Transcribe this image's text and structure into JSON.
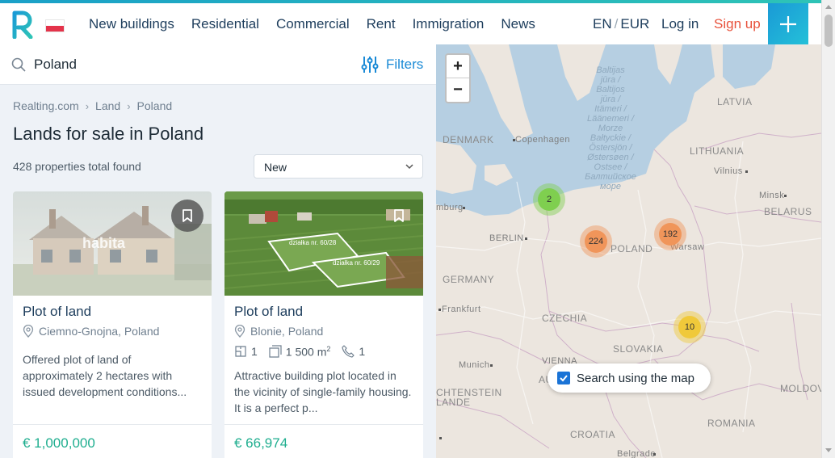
{
  "header": {
    "nav": [
      "New buildings",
      "Residential",
      "Commercial",
      "Rent",
      "Immigration",
      "News"
    ],
    "lang": "EN",
    "currency": "EUR",
    "login": "Log in",
    "signup": "Sign up",
    "accent_color": "#1a9ad6",
    "signup_color": "#e8523c"
  },
  "search": {
    "value": "Poland",
    "filters_label": "Filters"
  },
  "breadcrumb": [
    "Realting.com",
    "Land",
    "Poland"
  ],
  "page_title": "Lands for sale in Poland",
  "total_found": "428 properties total found",
  "sort": {
    "selected": "New"
  },
  "listings": [
    {
      "title": "Plot of land",
      "location": "Ciemno-Gnojna, Poland",
      "image_watermark": "habita",
      "description": "Offered plot of land of approximately 2 hectares with issued development conditions...",
      "price": "€ 1,000,000"
    },
    {
      "title": "Plot of land",
      "location": "Blonie, Poland",
      "plot_label_1": "działka nr. 60/28",
      "plot_label_2": "działka nr. 60/29",
      "features": {
        "rooms": "1",
        "area": "1 500 m",
        "area_sup": "2",
        "phone": "1"
      },
      "description": "Attractive building plot located in the vicinity of single-family housing. It is a perfect p...",
      "price": "€ 66,974"
    }
  ],
  "map": {
    "zoom_in": "+",
    "zoom_out": "−",
    "search_using_map": "Search using the map",
    "sea_label": [
      "Baltijas",
      "jūra /",
      "Baltijos",
      "jūra /",
      "Itämeri /",
      "Läänemeri /",
      "Morze",
      "Bałtyckie /",
      "Östersjön /",
      "Østersøen /",
      "Ostsee /",
      "Балтийское",
      "море"
    ],
    "labels": {
      "denmark": "DENMARK",
      "copenhagen": "Copenhagen",
      "latvia": "LATVIA",
      "lithuania": "LITHUANIA",
      "vilnius": "Vilnius",
      "minsk": "Minsk",
      "belarus": "BELARUS",
      "hamburg": "mburg",
      "berlin": "BERLIN",
      "poland": "POLAND",
      "warsaw": "Warsaw",
      "germany": "GERMANY",
      "frankfurt": "Frankfurt",
      "czechia": "CZECHIA",
      "slovakia": "SLOVAKIA",
      "munich": "Munich",
      "vienna": "VIENNA",
      "austria": "AUST",
      "liechtenstein": "CHTENSTEIN",
      "lande": "LANDE",
      "moldova": "MOLDOV",
      "romania": "ROMANIA",
      "croatia": "CROATIA",
      "belgrade": "Belgrade"
    },
    "clusters": [
      {
        "count": "2",
        "color": "#7fcf4f"
      },
      {
        "count": "224",
        "color": "#f0955a"
      },
      {
        "count": "192",
        "color": "#f0955a"
      },
      {
        "count": "10",
        "color": "#f0c93a"
      }
    ]
  }
}
